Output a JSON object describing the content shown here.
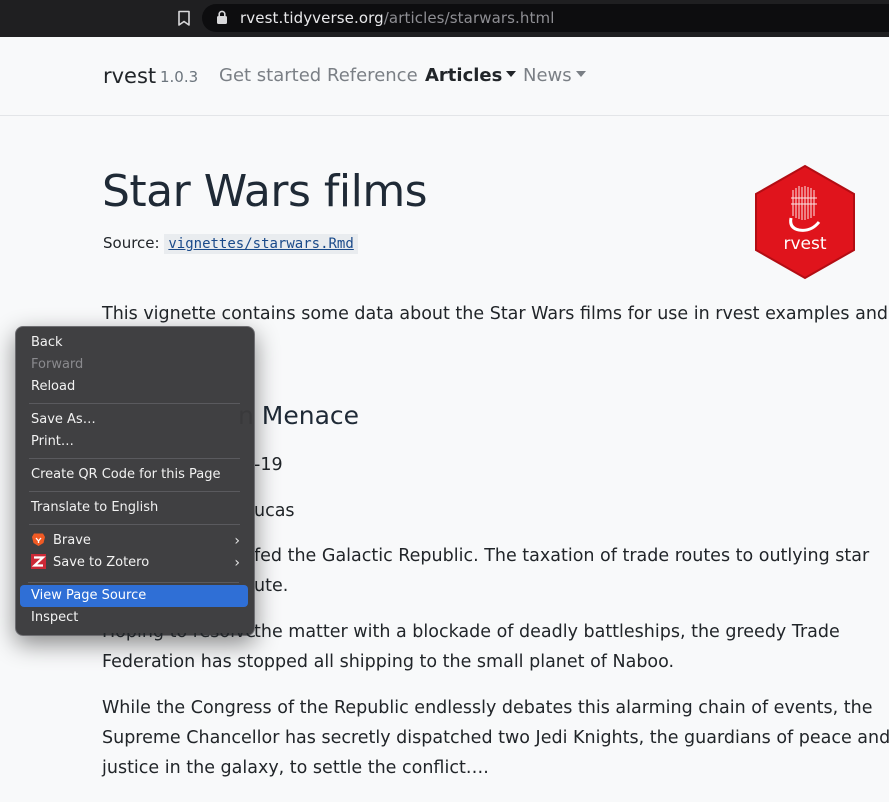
{
  "browser": {
    "url_domain": "rvest.tidyverse.org",
    "url_path": "/articles/starwars.html",
    "icons": [
      "bookmark-icon",
      "lock-icon"
    ]
  },
  "navbar": {
    "brand": "rvest",
    "version": "1.0.3",
    "links": [
      {
        "label": "Get started"
      },
      {
        "label": "Reference"
      },
      {
        "label": "Articles"
      },
      {
        "label": "News"
      }
    ]
  },
  "page": {
    "title": "Star Wars films",
    "source_label": "Source:",
    "source_file": "vignettes/starwars.Rmd",
    "logo_text": "rvest",
    "intro": "This vignette contains some data about the Star Wars films for use in rvest examples and",
    "heading_fragment": "n Menace",
    "line_date_fragment": "-19",
    "line_director_fragment": "ucas",
    "crawl_line1_fragment": "fed the Galactic Republic. The taxation of trade routes to outlying star",
    "crawl_line2_fragment": "ute.",
    "para2_line1_fragment": "the matter with a blockade of deadly battleships, the greedy Trade",
    "para2_line2": "Federation has stopped all shipping to the small planet of Naboo.",
    "para3_line1": "While the Congress of the Republic endlessly debates this alarming chain of events, the",
    "para3_line2": "Supreme Chancellor has secretly dispatched two Jedi Knights, the guardians of peace and",
    "para3_line3": "justice in the galaxy, to settle the conflict…."
  },
  "context_menu": {
    "back": "Back",
    "forward": "Forward",
    "reload": "Reload",
    "save_as": "Save As…",
    "print": "Print…",
    "qr": "Create QR Code for this Page",
    "translate": "Translate to English",
    "brave": "Brave",
    "zotero": "Save to Zotero",
    "view_source": "View Page Source",
    "inspect": "Inspect"
  },
  "colors": {
    "accent_highlight": "#2f6fd6",
    "logo_red": "#e0141c",
    "nav_active": "#212529",
    "nav_inactive": "#7a7f85"
  }
}
